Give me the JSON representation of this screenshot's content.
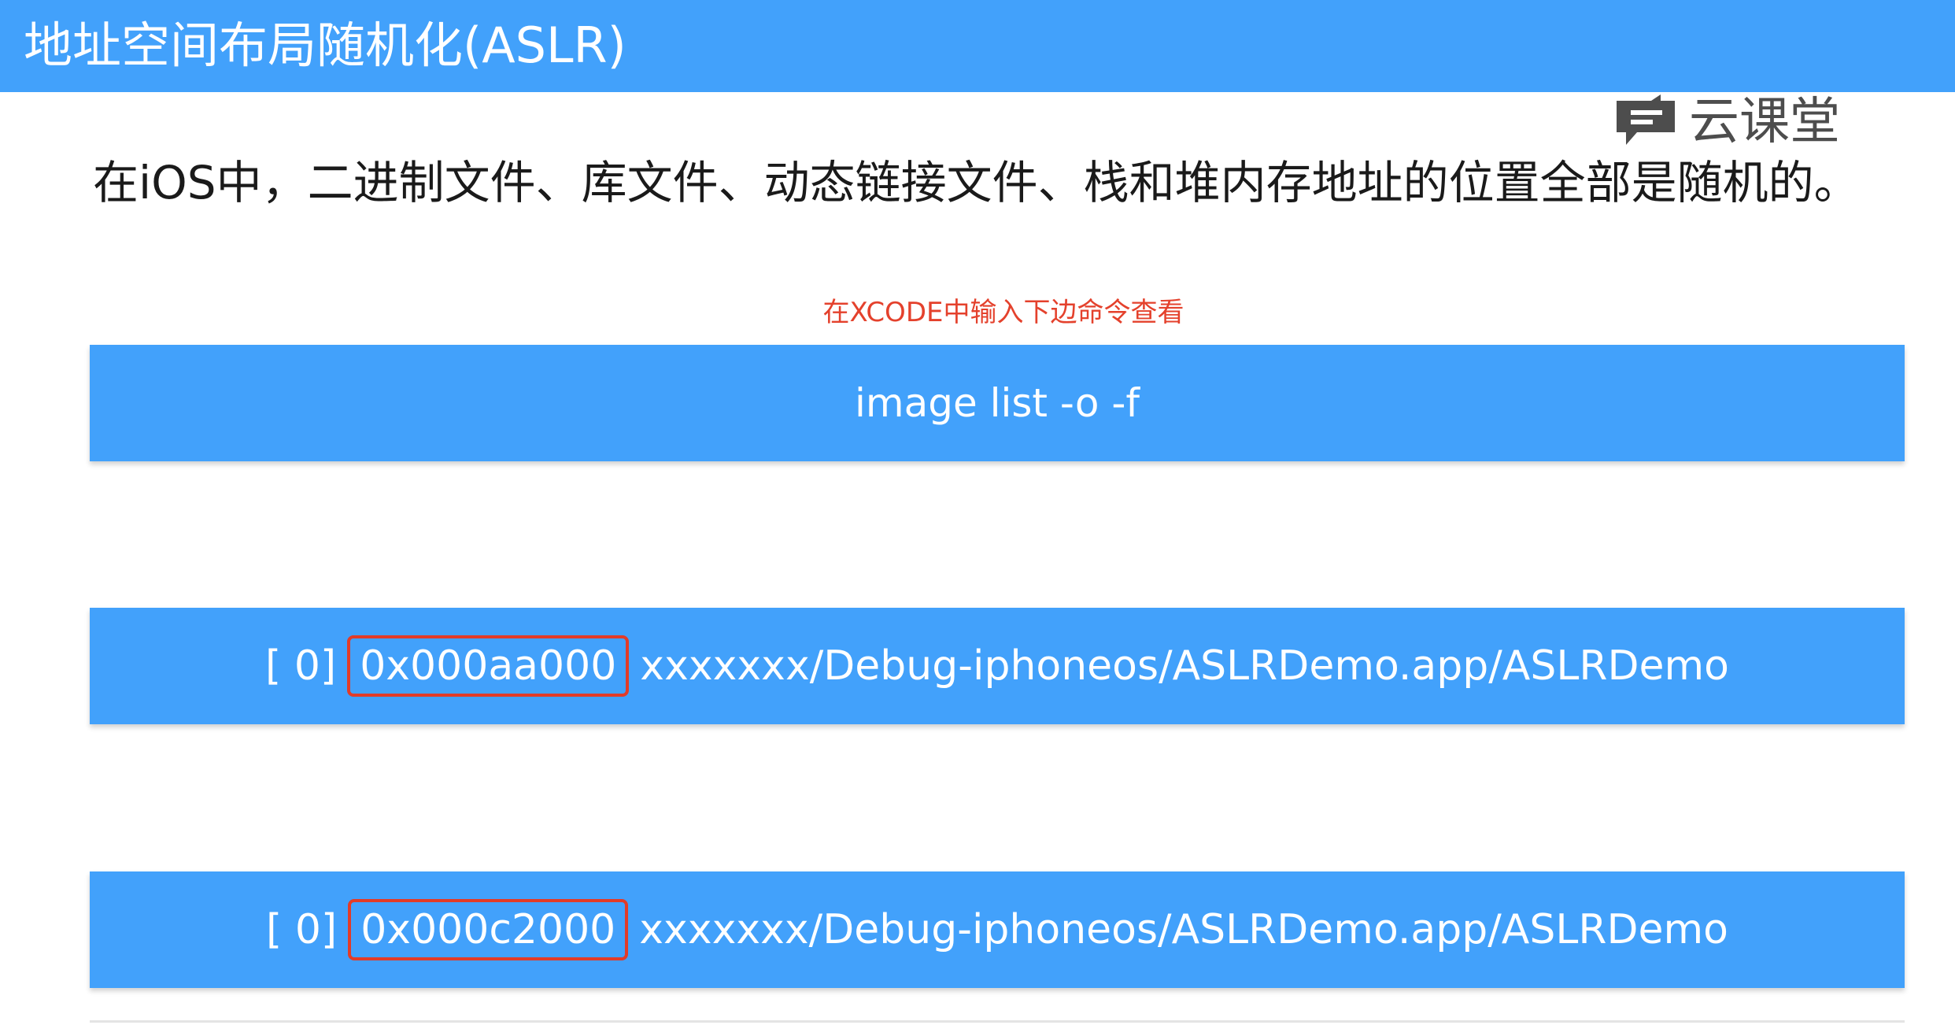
{
  "header": {
    "title": "地址空间布局随机化(ASLR)"
  },
  "watermark": {
    "icon": "chat-bubble-icon",
    "text": "云课堂"
  },
  "intro": {
    "text": "在iOS中，二进制文件、库文件、动态链接文件、栈和堆内存地址的位置全部是随机的。"
  },
  "hint": {
    "text": "在XCODE中输入下边命令查看"
  },
  "command": {
    "text": "image list -o -f"
  },
  "results": [
    {
      "index": "[ 0]",
      "address": "0x000aa000",
      "path": "xxxxxxx/Debug-iphoneos/ASLRDemo.app/ASLRDemo"
    },
    {
      "index": "[ 0]",
      "address": "0x000c2000",
      "path": "xxxxxxx/Debug-iphoneos/ASLRDemo.app/ASLRDemo"
    }
  ],
  "colors": {
    "accent": "#42a1fb",
    "highlight": "#e23b28",
    "hint": "#e4412c"
  }
}
